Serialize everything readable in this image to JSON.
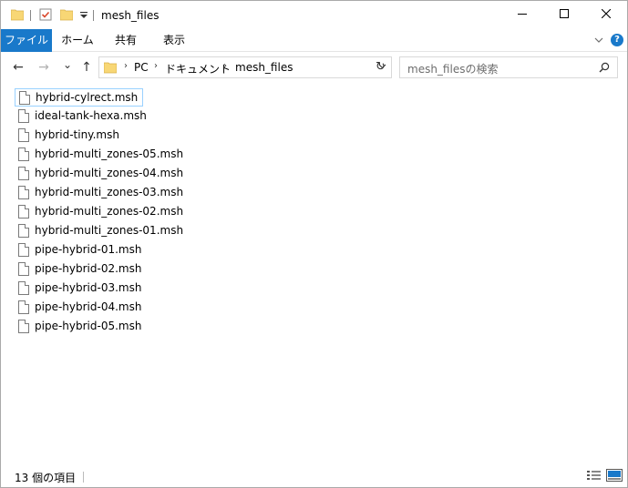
{
  "window": {
    "title": "mesh_files",
    "controls": {
      "minimize": "—",
      "maximize": "☐",
      "close": "✕"
    }
  },
  "ribbon": {
    "tabs": [
      {
        "label": "ファイル",
        "active": true
      },
      {
        "label": "ホーム"
      },
      {
        "label": "共有"
      },
      {
        "label": "表示"
      }
    ],
    "expand_icon": "chevron-down-icon",
    "help_label": "?"
  },
  "navigation": {
    "back": "←",
    "forward": "→",
    "recent": "⌄",
    "up": "↑",
    "breadcrumb": [
      "PC",
      "ドキュメント",
      "mesh_files"
    ],
    "refresh": "↻"
  },
  "search": {
    "placeholder": "mesh_filesの検索",
    "icon": "⚲"
  },
  "files": [
    {
      "name": "hybrid-cylrect.msh",
      "selected": true
    },
    {
      "name": "ideal-tank-hexa.msh"
    },
    {
      "name": "hybrid-tiny.msh"
    },
    {
      "name": "hybrid-multi_zones-05.msh"
    },
    {
      "name": "hybrid-multi_zones-04.msh"
    },
    {
      "name": "hybrid-multi_zones-03.msh"
    },
    {
      "name": "hybrid-multi_zones-02.msh"
    },
    {
      "name": "hybrid-multi_zones-01.msh"
    },
    {
      "name": "pipe-hybrid-01.msh"
    },
    {
      "name": "pipe-hybrid-02.msh"
    },
    {
      "name": "pipe-hybrid-03.msh"
    },
    {
      "name": "pipe-hybrid-04.msh"
    },
    {
      "name": "pipe-hybrid-05.msh"
    }
  ],
  "status": {
    "item_count": "13 個の項目"
  },
  "colors": {
    "accent": "#1979ca",
    "selection_border": "#99d1ff",
    "folder": "#f8d775"
  }
}
